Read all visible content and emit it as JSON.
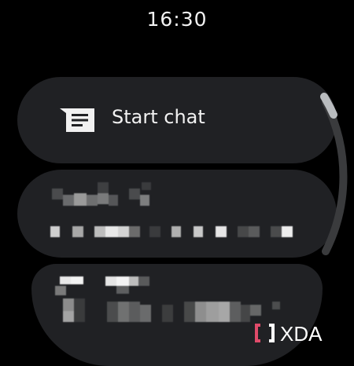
{
  "status": {
    "time": "16:30"
  },
  "start_chat": {
    "label": "Start chat",
    "icon": "message-lines-icon"
  },
  "conversations": [
    {
      "name": "",
      "preview": ""
    },
    {
      "name": "",
      "preview": ""
    }
  ],
  "watermark": {
    "text": "XDA",
    "accent": "#e04b6a"
  },
  "colors": {
    "background": "#000000",
    "card": "#202124",
    "scroll_track": "#3a3b3d",
    "scroll_thumb": "#b9bcbf"
  }
}
